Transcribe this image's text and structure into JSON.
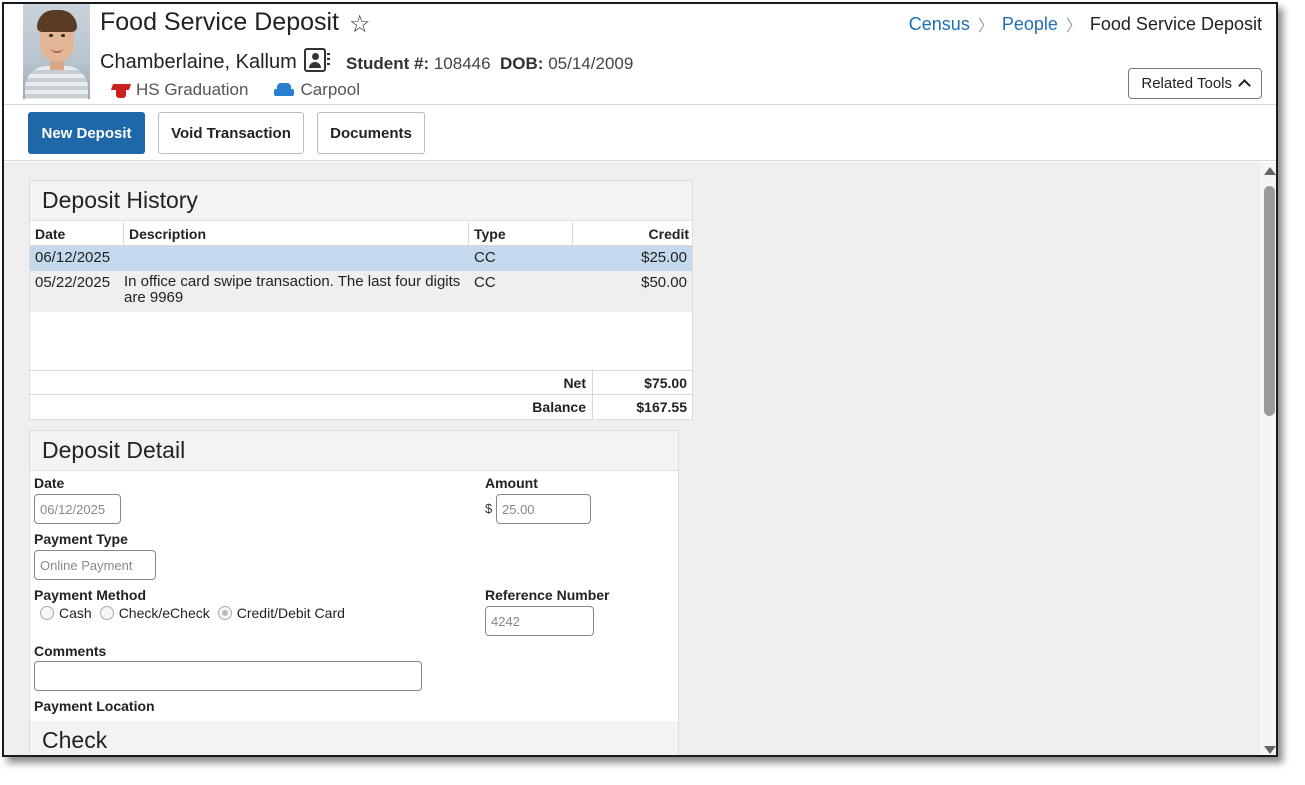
{
  "header": {
    "title": "Food Service Deposit",
    "breadcrumb": [
      "Census",
      "People",
      "Food Service Deposit"
    ],
    "student_name": "Chamberlaine, Kallum",
    "student_num_label": "Student #:",
    "student_num": "108446",
    "dob_label": "DOB:",
    "dob": "05/14/2009",
    "flags": [
      "HS Graduation",
      "Carpool"
    ],
    "related_tools": "Related Tools"
  },
  "toolbar": {
    "new_deposit": "New Deposit",
    "void_transaction": "Void Transaction",
    "documents": "Documents"
  },
  "history": {
    "title": "Deposit History",
    "columns": [
      "Date",
      "Description",
      "Type",
      "Credit"
    ],
    "rows": [
      {
        "date": "06/12/2025",
        "description": "",
        "type": "CC",
        "credit": "$25.00"
      },
      {
        "date": "05/22/2025",
        "description": "In office card swipe transaction. The last four digits are 9969",
        "type": "CC",
        "credit": "$50.00"
      }
    ],
    "net_label": "Net",
    "net_value": "$75.00",
    "balance_label": "Balance",
    "balance_value": "$167.55"
  },
  "detail": {
    "title": "Deposit Detail",
    "date_label": "Date",
    "date_value": "06/12/2025",
    "amount_label": "Amount",
    "amount_currency": "$",
    "amount_value": "25.00",
    "payment_type_label": "Payment Type",
    "payment_type_value": "Online Payment",
    "payment_method_label": "Payment Method",
    "payment_methods": [
      "Cash",
      "Check/eCheck",
      "Credit/Debit Card"
    ],
    "reference_label": "Reference Number",
    "reference_value": "4242",
    "comments_label": "Comments",
    "comments_value": "",
    "payment_location_label": "Payment Location",
    "check_title": "Check"
  },
  "colors": {
    "primary_button": "#1e67a8",
    "link": "#1f6fb5",
    "selected_row": "#c5d9ec"
  }
}
